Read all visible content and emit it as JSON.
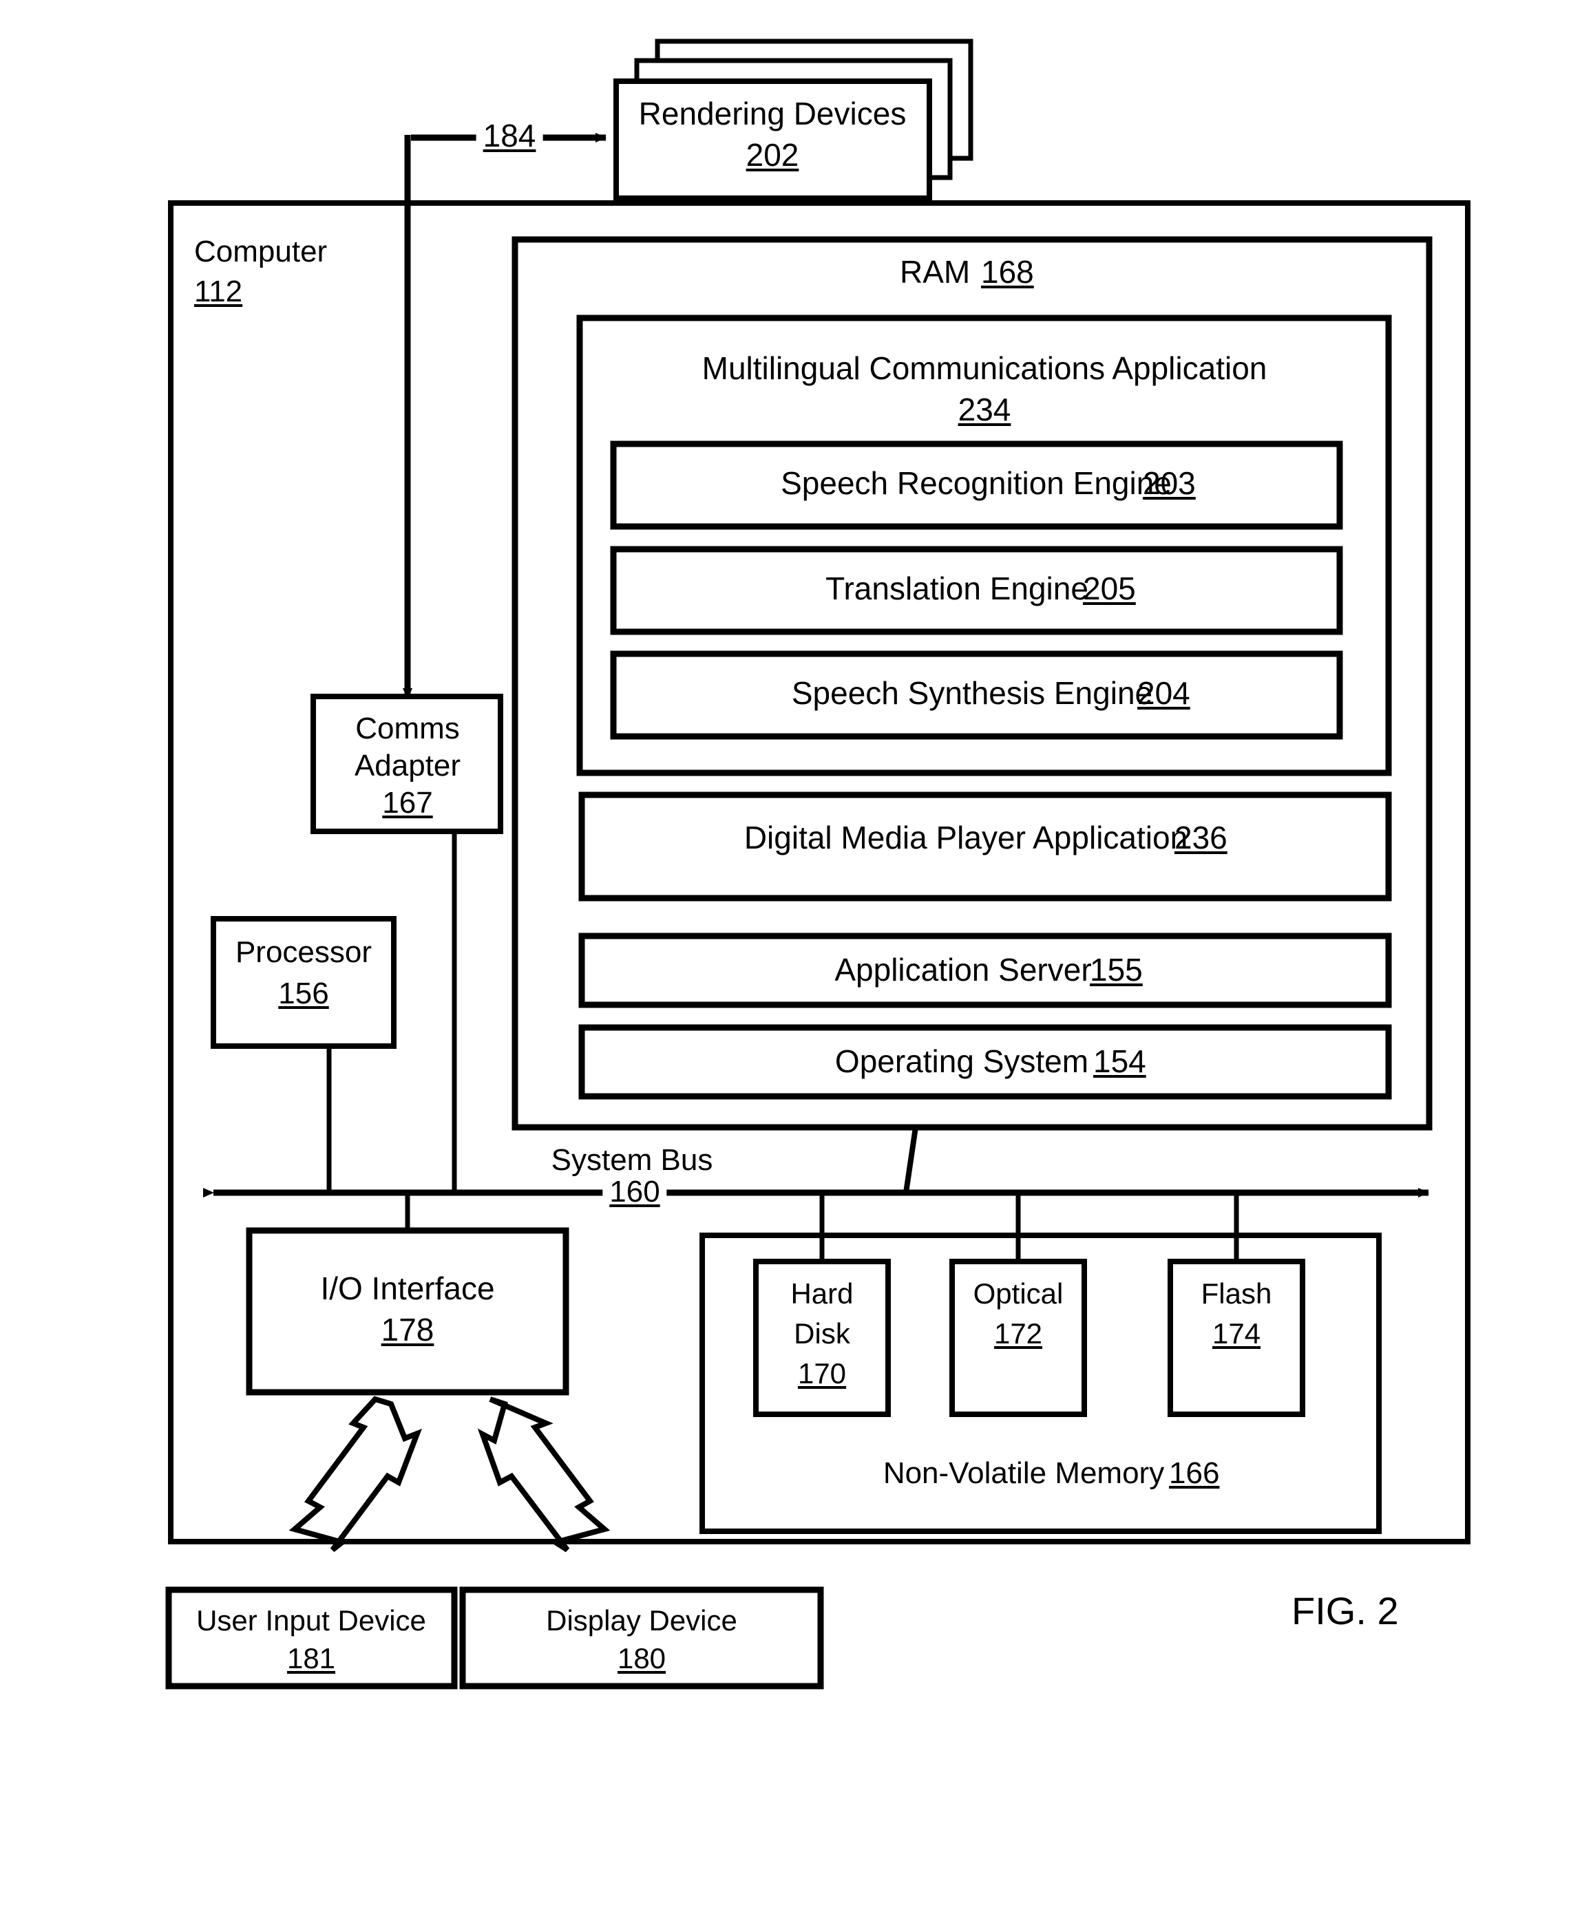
{
  "figure": {
    "label": "FIG. 2",
    "type": "block-diagram"
  },
  "rendering_devices": {
    "title": "Rendering Devices",
    "ref": "202",
    "stack_count": 3
  },
  "connections": {
    "network_link_ref": "184"
  },
  "computer": {
    "title": "Computer",
    "ref": "112"
  },
  "ram": {
    "title": "RAM",
    "ref": "168"
  },
  "multilingual_app": {
    "title": "Multilingual Communications Application",
    "ref": "234",
    "engines": [
      {
        "title": "Speech Recognition Engine",
        "ref": "203"
      },
      {
        "title": "Translation Engine",
        "ref": "205"
      },
      {
        "title": "Speech Synthesis Engine",
        "ref": "204"
      }
    ]
  },
  "ram_modules": [
    {
      "title": "Digital Media Player Application",
      "ref": "236"
    },
    {
      "title": "Application Server",
      "ref": "155"
    },
    {
      "title": "Operating System",
      "ref": "154"
    }
  ],
  "comms_adapter": {
    "line1": "Comms",
    "line2": "Adapter",
    "ref": "167"
  },
  "processor": {
    "title": "Processor",
    "ref": "156"
  },
  "system_bus": {
    "title": "System Bus",
    "ref": "160"
  },
  "io_interface": {
    "title": "I/O Interface",
    "ref": "178"
  },
  "non_volatile_memory": {
    "title": "Non-Volatile Memory",
    "ref": "166",
    "drives": [
      {
        "line1": "Hard",
        "line2": "Disk",
        "ref": "170"
      },
      {
        "line1": "Optical",
        "line2": "",
        "ref": "172"
      },
      {
        "line1": "Flash",
        "line2": "",
        "ref": "174"
      }
    ]
  },
  "peripherals": [
    {
      "title": "User Input Device",
      "ref": "181"
    },
    {
      "title": "Display Device",
      "ref": "180"
    }
  ],
  "colors": {
    "stroke": "#000000",
    "fill": "#ffffff"
  }
}
